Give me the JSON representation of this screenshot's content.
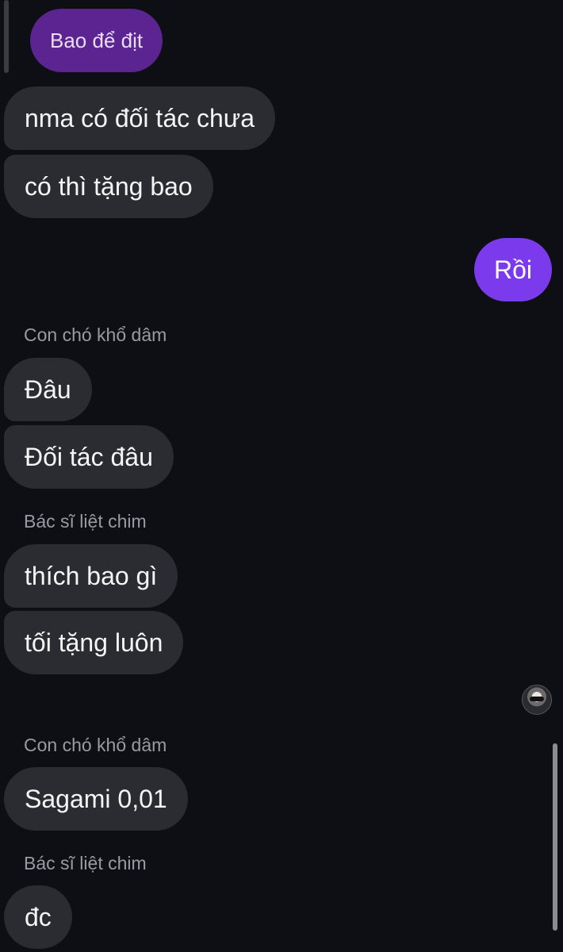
{
  "reply_quote": {
    "text": "Bao để địt"
  },
  "messages": [
    {
      "text": "nma có đối tác chưa"
    },
    {
      "text": "có thì tặng bao"
    },
    {
      "text": "Rồi"
    },
    {
      "sender": "Con chó khổ dâm"
    },
    {
      "text": "Đâu"
    },
    {
      "text": "Đối tác đâu"
    },
    {
      "sender": "Bác sĩ liệt chim"
    },
    {
      "text": "thích bao gì"
    },
    {
      "text": "tối tặng luôn"
    },
    {
      "sender": "Con chó khổ dâm"
    },
    {
      "text": "Sagami 0,01"
    },
    {
      "sender": "Bác sĩ liệt chim"
    },
    {
      "text": "đc"
    }
  ],
  "icons": {
    "read_receipt_avatar": "user-avatar-icon"
  },
  "colors": {
    "background": "#0d0f14",
    "incoming_bubble": "#2a2c31",
    "outgoing_bubble": "#7c3aed",
    "reply_quote_bubble": "#5b2490",
    "sender_name": "#9a9ba2"
  }
}
